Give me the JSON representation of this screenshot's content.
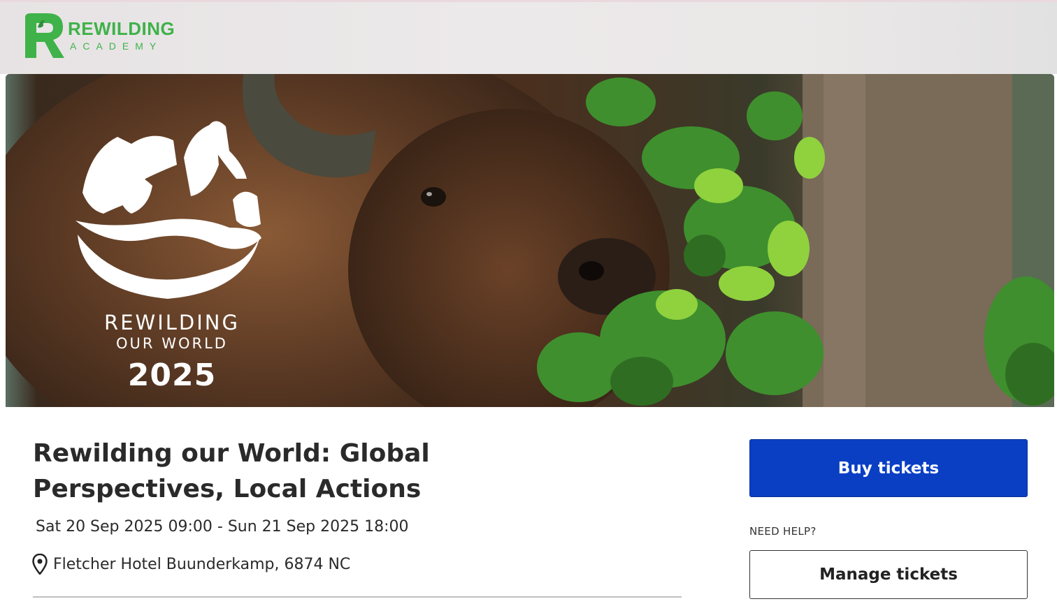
{
  "brand": {
    "name_line1": "REWILDING",
    "name_line2": "ACADEMY",
    "color": "#3fb24a"
  },
  "hero": {
    "caption_line1": "REWILDING",
    "caption_line2": "OUR WORLD",
    "caption_year": "2025",
    "emblem_icon": "rewilding-emblem-icon"
  },
  "event": {
    "title": "Rewilding our World: Global Perspectives, Local Actions",
    "date_range": "Sat 20 Sep 2025 09:00 - Sun 21 Sep 2025 18:00",
    "location": "Fletcher Hotel Buunderkamp, 6874 NC",
    "location_icon": "map-pin-icon"
  },
  "actions": {
    "buy_label": "Buy tickets",
    "need_help_label": "NEED HELP?",
    "manage_label": "Manage tickets",
    "buy_color": "#0a3fc4"
  }
}
